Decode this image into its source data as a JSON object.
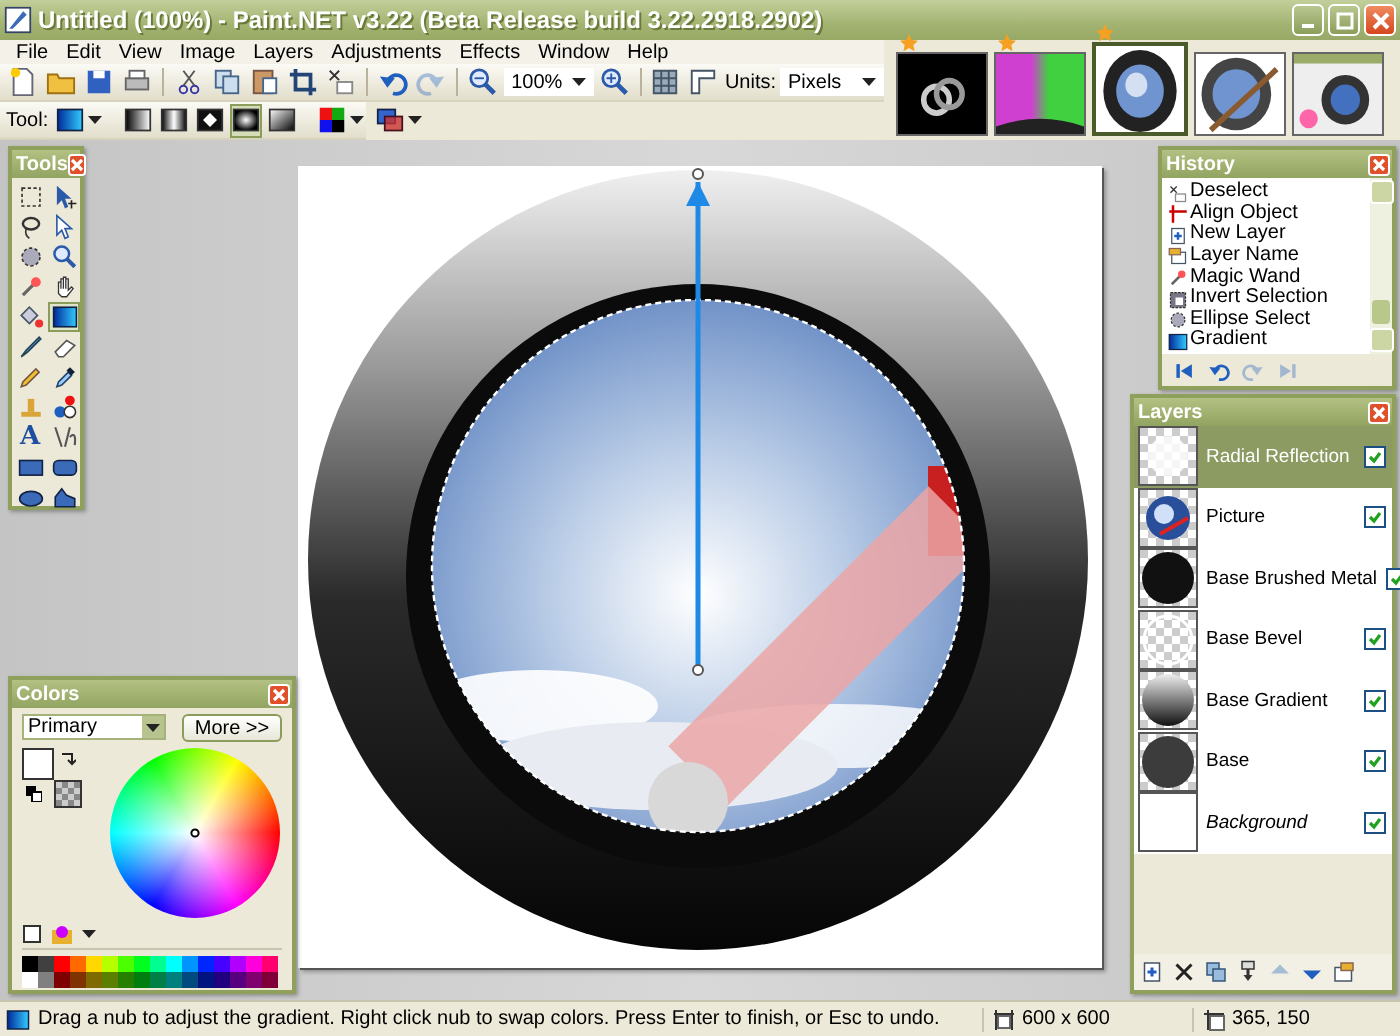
{
  "window": {
    "title": "Untitled (100%) - Paint.NET v3.22 (Beta Release build 3.22.2918.2902)"
  },
  "menu": [
    "File",
    "Edit",
    "View",
    "Image",
    "Layers",
    "Adjustments",
    "Effects",
    "Window",
    "Help"
  ],
  "toolbar": {
    "buttons": [
      {
        "kind": "new",
        "disabled": false
      },
      {
        "kind": "open",
        "disabled": false
      },
      {
        "kind": "save",
        "disabled": false
      },
      {
        "kind": "print",
        "disabled": false
      },
      {
        "kind": "sep"
      },
      {
        "kind": "cut",
        "disabled": false
      },
      {
        "kind": "copy",
        "disabled": false
      },
      {
        "kind": "paste",
        "disabled": false
      },
      {
        "kind": "crop",
        "disabled": false
      },
      {
        "kind": "deselect",
        "disabled": false
      },
      {
        "kind": "sep"
      },
      {
        "kind": "undo",
        "disabled": false
      },
      {
        "kind": "redo",
        "disabled": true
      },
      {
        "kind": "sep"
      },
      {
        "kind": "zoomout",
        "disabled": false
      }
    ],
    "zoom": "100%",
    "after_zoom": [
      {
        "kind": "zoomin",
        "disabled": false
      },
      {
        "kind": "sep"
      },
      {
        "kind": "grid",
        "disabled": false
      },
      {
        "kind": "ruler",
        "disabled": false
      }
    ],
    "units_label": "Units:",
    "units": "Pixels",
    "tool_label": "Tool:",
    "gradient_types": [
      {
        "kind": "linear",
        "selected": false
      },
      {
        "kind": "reflected",
        "selected": false
      },
      {
        "kind": "diamond",
        "selected": false
      },
      {
        "kind": "radial",
        "selected": true
      },
      {
        "kind": "conical",
        "selected": false
      }
    ]
  },
  "thumbnails": [
    {
      "kind": "rings",
      "starred": true,
      "selected": false
    },
    {
      "kind": "rays",
      "starred": true,
      "selected": false
    },
    {
      "kind": "orb",
      "starred": true,
      "selected": true
    },
    {
      "kind": "orb-brush",
      "starred": false,
      "selected": false
    },
    {
      "kind": "screenshot",
      "starred": false,
      "selected": false
    }
  ],
  "tools": {
    "title": "Tools",
    "items": [
      {
        "kind": "select",
        "selected": false
      },
      {
        "kind": "move",
        "selected": false
      },
      {
        "kind": "lasso",
        "selected": false
      },
      {
        "kind": "move-selection",
        "selected": false
      },
      {
        "kind": "ellipse-select",
        "selected": false
      },
      {
        "kind": "zoom",
        "selected": false
      },
      {
        "kind": "magic-wand",
        "selected": false
      },
      {
        "kind": "pan",
        "selected": false
      },
      {
        "kind": "bucket",
        "selected": false
      },
      {
        "kind": "gradient",
        "selected": true
      },
      {
        "kind": "brush",
        "selected": false
      },
      {
        "kind": "eraser",
        "selected": false
      },
      {
        "kind": "pencil",
        "selected": false
      },
      {
        "kind": "picker",
        "selected": false
      },
      {
        "kind": "stamp",
        "selected": false
      },
      {
        "kind": "recolor",
        "selected": false
      },
      {
        "kind": "text",
        "label": "A",
        "selected": false
      },
      {
        "kind": "line",
        "selected": false
      },
      {
        "kind": "rectangle",
        "selected": false
      },
      {
        "kind": "rounded-rectangle",
        "selected": false
      },
      {
        "kind": "ellipse",
        "selected": false
      },
      {
        "kind": "freeform",
        "selected": false
      }
    ]
  },
  "history": {
    "title": "History",
    "items": [
      {
        "kind": "deselect",
        "label": "Deselect"
      },
      {
        "kind": "align",
        "label": "Align Object"
      },
      {
        "kind": "new-layer",
        "label": "New Layer"
      },
      {
        "kind": "layer-name",
        "label": "Layer Name"
      },
      {
        "kind": "magic-wand",
        "label": "Magic Wand"
      },
      {
        "kind": "invert",
        "label": "Invert Selection"
      },
      {
        "kind": "ellipse-select",
        "label": "Ellipse Select"
      },
      {
        "kind": "gradient",
        "label": "Gradient"
      }
    ],
    "buttons": [
      {
        "kind": "first",
        "disabled": false
      },
      {
        "kind": "undo",
        "disabled": false
      },
      {
        "kind": "redo",
        "disabled": true
      },
      {
        "kind": "last",
        "disabled": true
      }
    ]
  },
  "layers": {
    "title": "Layers",
    "items": [
      {
        "kind": "reflection",
        "name": "Radial Reflection",
        "selected": true,
        "visible": true
      },
      {
        "kind": "picture",
        "name": "Picture",
        "selected": false,
        "visible": true
      },
      {
        "kind": "metal",
        "name": "Base Brushed Metal",
        "selected": false,
        "visible": true
      },
      {
        "kind": "bevel",
        "name": "Base Bevel",
        "selected": false,
        "visible": true
      },
      {
        "kind": "gradient",
        "name": "Base Gradient",
        "selected": false,
        "visible": true
      },
      {
        "kind": "base",
        "name": "Base",
        "selected": false,
        "visible": true
      },
      {
        "kind": "background",
        "name": "Background",
        "selected": false,
        "visible": true
      }
    ],
    "buttons": [
      {
        "kind": "add",
        "disabled": false
      },
      {
        "kind": "delete",
        "disabled": false
      },
      {
        "kind": "duplicate",
        "disabled": false
      },
      {
        "kind": "merge",
        "disabled": false
      },
      {
        "kind": "up",
        "disabled": true
      },
      {
        "kind": "down",
        "disabled": false
      },
      {
        "kind": "properties",
        "disabled": false
      }
    ]
  },
  "colors": {
    "title": "Colors",
    "mode": "Primary",
    "more": "More >>",
    "palette": [
      {
        "color": "#000000"
      },
      {
        "color": "#404040"
      },
      {
        "color": "#ff0000"
      },
      {
        "color": "#ff6a00"
      },
      {
        "color": "#ffd800"
      },
      {
        "color": "#b6ff00"
      },
      {
        "color": "#4cff00"
      },
      {
        "color": "#00ff21"
      },
      {
        "color": "#00ff90"
      },
      {
        "color": "#00ffff"
      },
      {
        "color": "#0094ff"
      },
      {
        "color": "#0026ff"
      },
      {
        "color": "#4800ff"
      },
      {
        "color": "#b200ff"
      },
      {
        "color": "#ff00dc"
      },
      {
        "color": "#ff006e"
      },
      {
        "color": "#ffffff"
      },
      {
        "color": "#808080"
      },
      {
        "color": "#7f0000"
      },
      {
        "color": "#7f3300"
      },
      {
        "color": "#7f6a00"
      },
      {
        "color": "#5b7f00"
      },
      {
        "color": "#267f00"
      },
      {
        "color": "#007f0e"
      },
      {
        "color": "#007f46"
      },
      {
        "color": "#007f7f"
      },
      {
        "color": "#004a7f"
      },
      {
        "color": "#00137f"
      },
      {
        "color": "#21007f"
      },
      {
        "color": "#57007f"
      },
      {
        "color": "#7f006e"
      },
      {
        "color": "#7f0037"
      }
    ]
  },
  "status": {
    "hint": "Drag a nub to adjust the gradient. Right click nub to swap colors. Press Enter to finish, or Esc to undo.",
    "size": "600 x 600",
    "cursor": "365, 150"
  }
}
